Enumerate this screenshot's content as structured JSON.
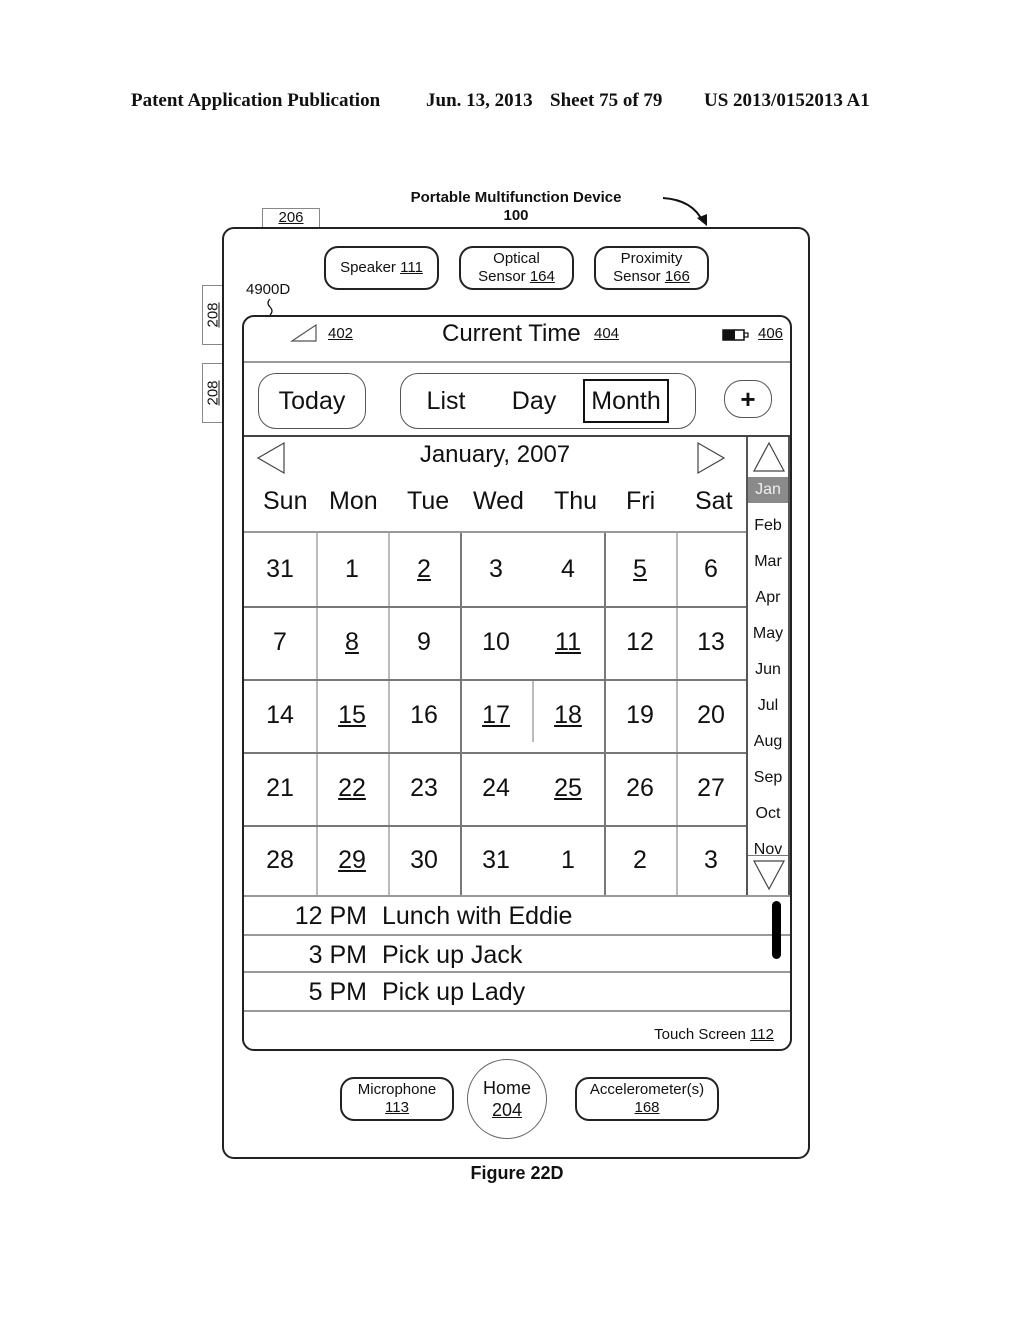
{
  "header": {
    "left": "Patent Application Publication",
    "date": "Jun. 13, 2013",
    "sheet": "Sheet 75 of 79",
    "pub_number": "US 2013/0152013 A1"
  },
  "device": {
    "title": "Portable Multifunction Device",
    "number": "100",
    "tab_label": "206",
    "side_labels": [
      "208",
      "208"
    ],
    "screen_ref": "4900D",
    "sensors": [
      {
        "label": "Speaker",
        "ref": "111"
      },
      {
        "label": "Optical",
        "label2": "Sensor",
        "ref": "164"
      },
      {
        "label": "Proximity",
        "label2": "Sensor",
        "ref": "166"
      }
    ],
    "bottom": [
      {
        "label": "Microphone",
        "ref": "113"
      },
      {
        "label": "Home",
        "ref": "204"
      },
      {
        "label": "Accelerometer(s)",
        "ref": "168"
      }
    ]
  },
  "status_bar": {
    "signal_ref": "402",
    "title": "Current Time",
    "title_ref": "404",
    "battery_ref": "406"
  },
  "toolbar": {
    "today": "Today",
    "segments": [
      "List",
      "Day",
      "Month"
    ],
    "selected_segment": "Month",
    "add": "+"
  },
  "calendar": {
    "title": "January, 2007",
    "day_names": [
      "Sun",
      "Mon",
      "Tue",
      "Wed",
      "Thu",
      "Fri",
      "Sat"
    ],
    "weeks": [
      [
        {
          "d": "31"
        },
        {
          "d": "1"
        },
        {
          "d": "2",
          "ev": true
        },
        {
          "d": "3"
        },
        {
          "d": "4"
        },
        {
          "d": "5",
          "ev": true
        },
        {
          "d": "6"
        }
      ],
      [
        {
          "d": "7"
        },
        {
          "d": "8",
          "ev": true
        },
        {
          "d": "9"
        },
        {
          "d": "10"
        },
        {
          "d": "11",
          "ev": true
        },
        {
          "d": "12"
        },
        {
          "d": "13"
        }
      ],
      [
        {
          "d": "14"
        },
        {
          "d": "15",
          "ev": true
        },
        {
          "d": "16"
        },
        {
          "d": "17",
          "ev": true
        },
        {
          "d": "18",
          "ev": true
        },
        {
          "d": "19"
        },
        {
          "d": "20"
        }
      ],
      [
        {
          "d": "21"
        },
        {
          "d": "22",
          "ev": true
        },
        {
          "d": "23"
        },
        {
          "d": "24"
        },
        {
          "d": "25",
          "ev": true
        },
        {
          "d": "26"
        },
        {
          "d": "27"
        }
      ],
      [
        {
          "d": "28"
        },
        {
          "d": "29",
          "ev": true
        },
        {
          "d": "30"
        },
        {
          "d": "31"
        },
        {
          "d": "1"
        },
        {
          "d": "2"
        },
        {
          "d": "3"
        }
      ]
    ],
    "months": [
      "Jan",
      "Feb",
      "Mar",
      "Apr",
      "May",
      "Jun",
      "Jul",
      "Aug",
      "Sep",
      "Oct",
      "Nov"
    ],
    "selected_month": "Jan"
  },
  "events": [
    {
      "time": "12 PM",
      "title": "Lunch with Eddie"
    },
    {
      "time": "3 PM",
      "title": "Pick up Jack"
    },
    {
      "time": "5 PM",
      "title": "Pick up Lady"
    }
  ],
  "touch_screen": {
    "label": "Touch Screen",
    "ref": "112"
  },
  "figure_caption": "Figure 22D",
  "colors": {
    "selected_month_bg": "#8a8a8a",
    "line": "#222222"
  }
}
